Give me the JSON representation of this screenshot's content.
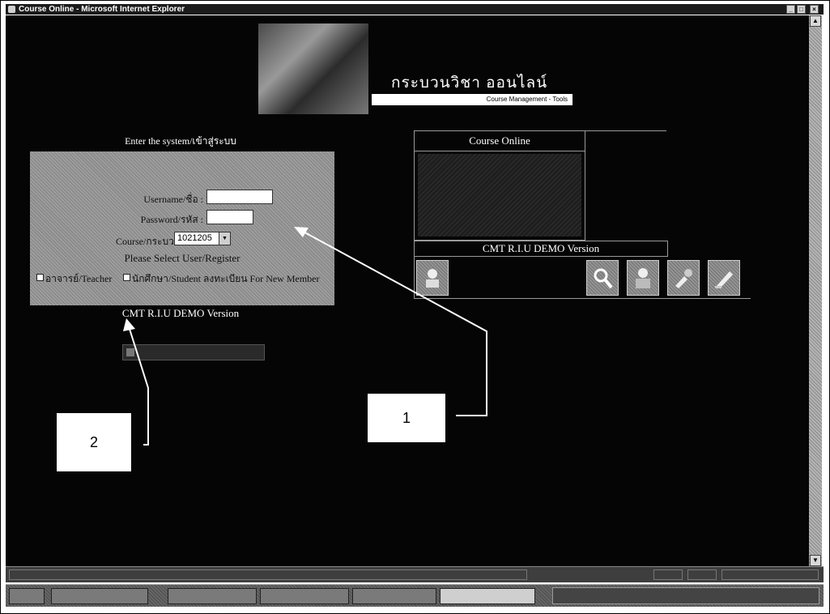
{
  "window": {
    "title": "Course Online - Microsoft Internet Explorer",
    "controls": {
      "minimize": "_",
      "maximize": "□",
      "close": "×"
    }
  },
  "banner": {
    "title": "กระบวนวิชา ออนไลน์",
    "subtitle": "Course Management - Tools"
  },
  "login": {
    "heading": "Enter the system/เข้าสู่ระบบ",
    "username_label": "Username/ชื่อ :",
    "username_value": "",
    "password_label": "Password/รหัส :",
    "password_value": "",
    "course_label": "Course/กระบวนวิชา :",
    "course_value": "1021205",
    "select_prompt": "Please Select User/Register",
    "teacher_option": "อาจารย์/Teacher",
    "student_option": "นักศึกษา/Student ลงทะเบียน For New Member",
    "footer": "CMT R.I.U DEMO Version"
  },
  "course_panel": {
    "heading": "Course Online",
    "demo_label": "CMT R.I.U DEMO Version",
    "icons": [
      "student-icon",
      "search-icon",
      "teacher-icon",
      "tools-icon",
      "edit-icon"
    ]
  },
  "callouts": {
    "one": "1",
    "two": "2"
  },
  "colors": {
    "page": "#050505",
    "panel": "#8c8c8c",
    "callout": "#ffffff"
  }
}
